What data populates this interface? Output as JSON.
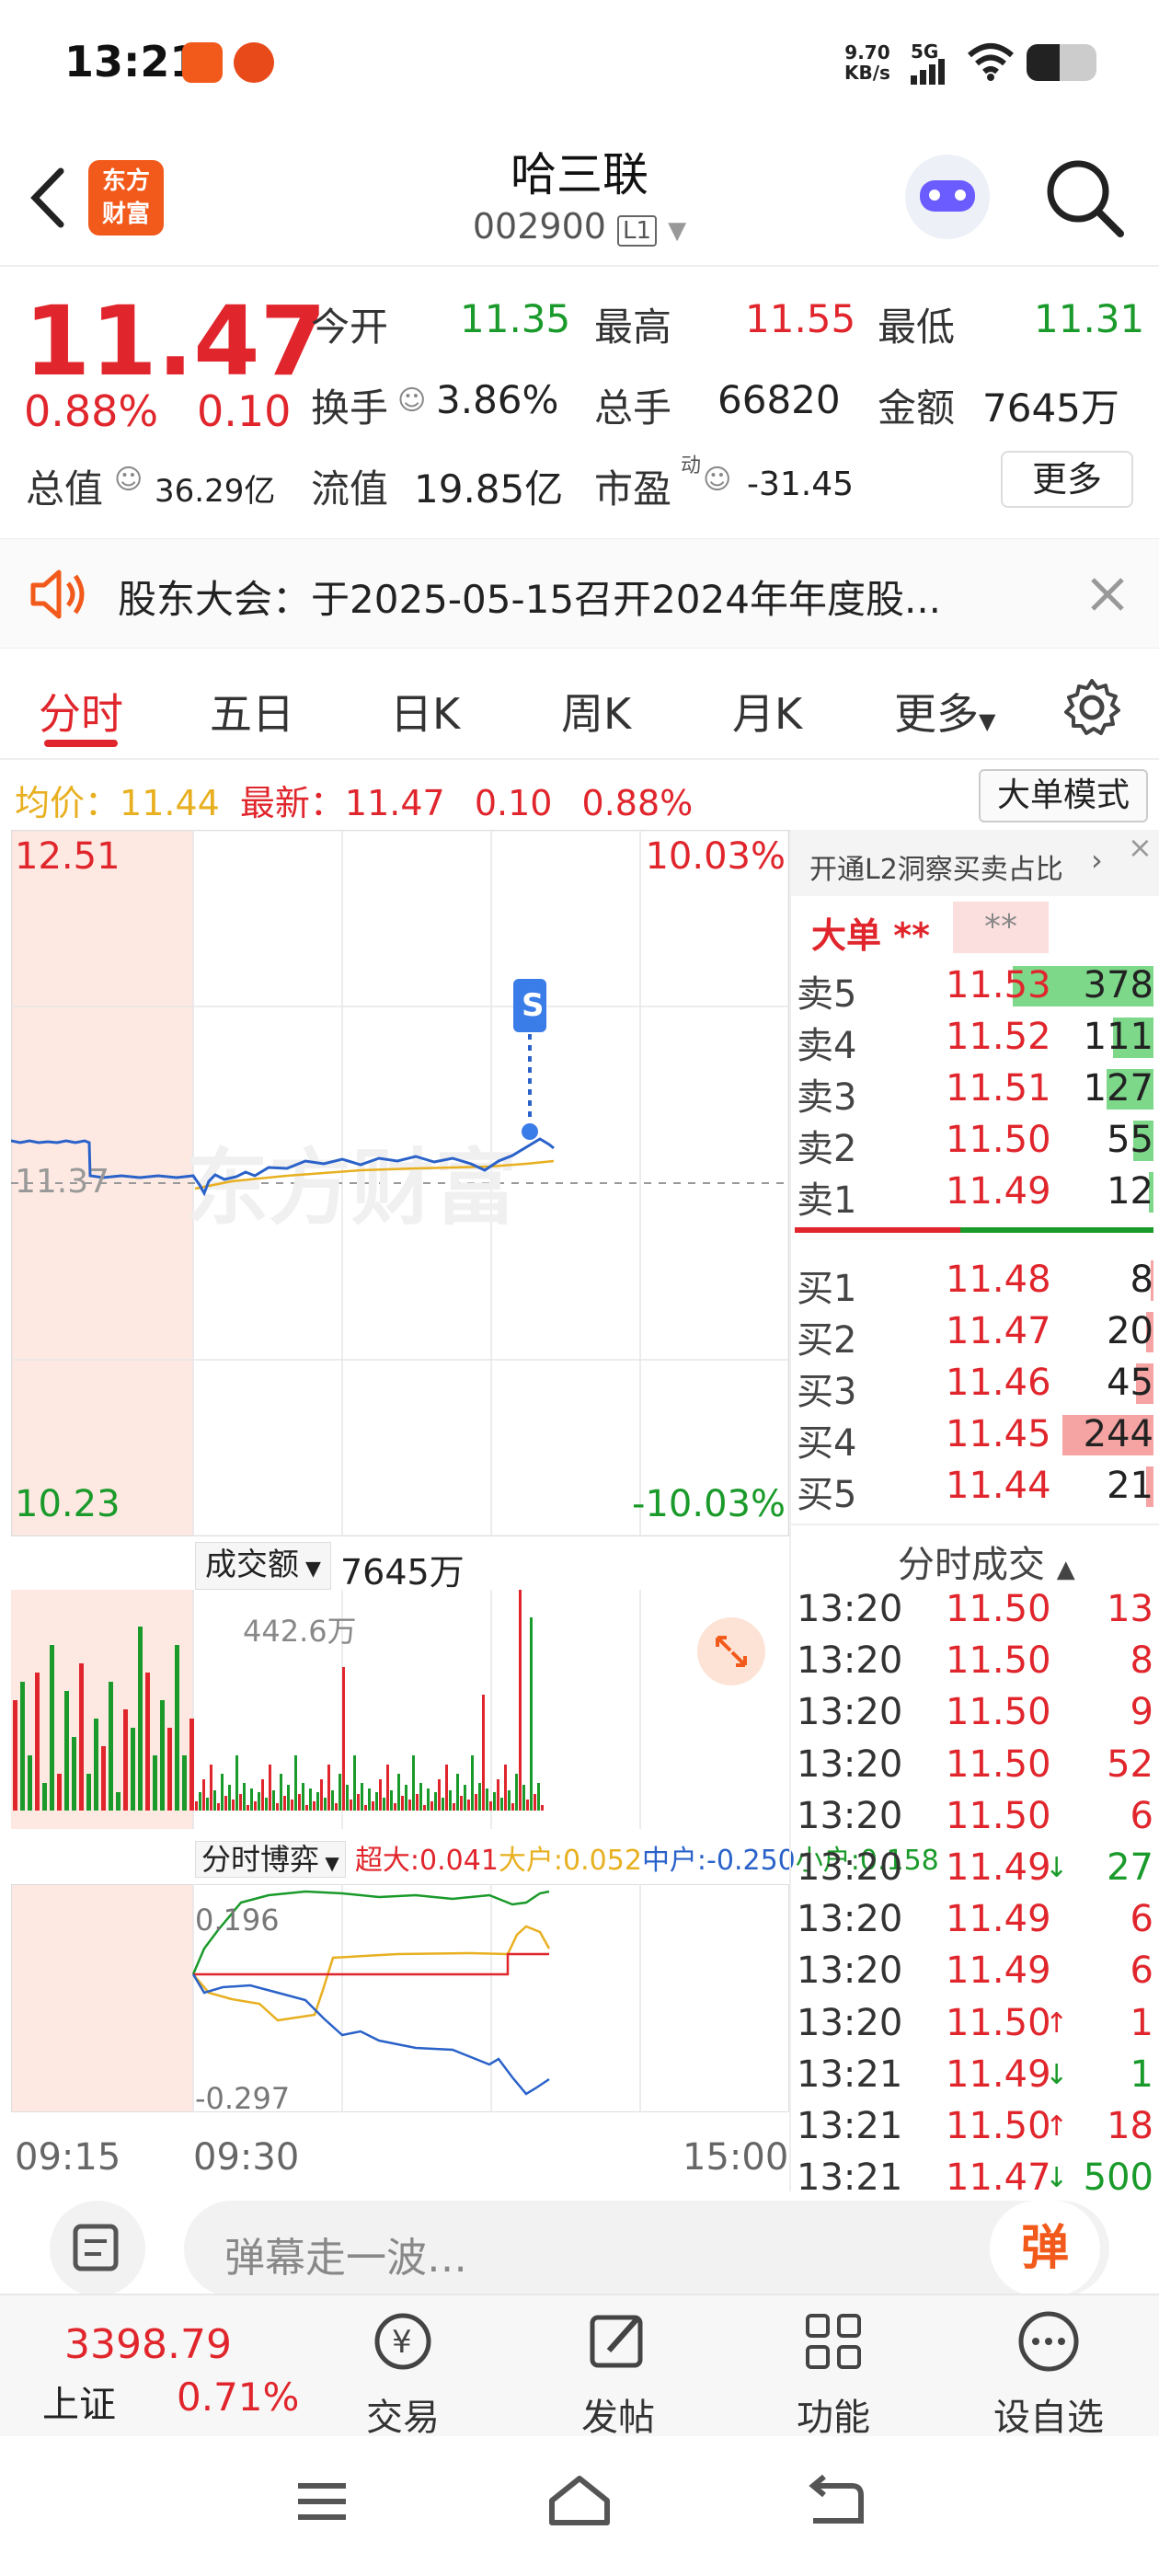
{
  "status": {
    "time": "13:21",
    "speed_value": "9.70",
    "speed_unit": "KB/s",
    "network": "5G"
  },
  "header": {
    "logo_line1": "东方",
    "logo_line2": "财富",
    "title": "哈三联",
    "code": "002900",
    "level": "L1"
  },
  "quote": {
    "price": "11.47",
    "change_pct": "0.88%",
    "change": "0.10",
    "open_label": "今开",
    "open": "11.35",
    "high_label": "最高",
    "high": "11.55",
    "low_label": "最低",
    "low": "11.31",
    "turnover_label": "换手",
    "turnover": "3.86%",
    "volume_label": "总手",
    "volume": "66820",
    "amount_label": "金额",
    "amount": "7645万",
    "mktcap_label": "总值",
    "mktcap": "36.29亿",
    "float_label": "流值",
    "float": "19.85亿",
    "pe_label": "市盈",
    "pe_sup": "动",
    "pe": "-31.45",
    "more": "更多"
  },
  "notice": {
    "text": "股东大会：于2025-05-15召开2024年年度股..."
  },
  "tabs": [
    "分时",
    "五日",
    "日K",
    "周K",
    "月K",
    "更多"
  ],
  "info": {
    "avg_label": "均价：",
    "avg": "11.44",
    "latest_label": "最新：",
    "latest": "11.47",
    "chg": "0.10",
    "pct": "0.88%",
    "mode_button": "大单模式"
  },
  "price_chart": {
    "top": "12.51",
    "mid": "11.37",
    "bottom": "10.23",
    "top_pct": "10.03%",
    "bottom_pct": "-10.03%",
    "watermark": "东方财富",
    "marker": "S"
  },
  "volume_chart": {
    "selector": "成交额",
    "total": "7645万",
    "max_label": "442.6万"
  },
  "bogame": {
    "selector": "分时博弈",
    "chaoda": "超大:0.041",
    "dahu": "大户:0.052",
    "zhonghu": "中户:-0.250",
    "xiaohu": "小户:0.158",
    "max_label": "0.196",
    "min_label": "-0.297"
  },
  "time_axis": {
    "start": "09:15",
    "open": "09:30",
    "end": "15:00"
  },
  "order_book": {
    "l2_banner": "开通L2洞察买卖占比",
    "big_label": "大单",
    "big_v1": "**",
    "big_v2": "**",
    "asks": [
      {
        "label": "卖5",
        "price": "11.53",
        "vol": "378",
        "bar": 0.9
      },
      {
        "label": "卖4",
        "price": "11.52",
        "vol": "111",
        "bar": 0.26
      },
      {
        "label": "卖3",
        "price": "11.51",
        "vol": "127",
        "bar": 0.3
      },
      {
        "label": "卖2",
        "price": "11.50",
        "vol": "55",
        "bar": 0.13
      },
      {
        "label": "卖1",
        "price": "11.49",
        "vol": "12",
        "bar": 0.03
      }
    ],
    "bids": [
      {
        "label": "买1",
        "price": "11.48",
        "vol": "8",
        "bar": 0.02
      },
      {
        "label": "买2",
        "price": "11.47",
        "vol": "20",
        "bar": 0.05
      },
      {
        "label": "买3",
        "price": "11.46",
        "vol": "45",
        "bar": 0.11
      },
      {
        "label": "买4",
        "price": "11.45",
        "vol": "244",
        "bar": 0.58
      },
      {
        "label": "买5",
        "price": "11.44",
        "vol": "21",
        "bar": 0.05
      }
    ]
  },
  "trades": {
    "title": "分时成交",
    "rows": [
      {
        "time": "13:20",
        "price": "11.50",
        "vol": "13",
        "arrow": ""
      },
      {
        "time": "13:20",
        "price": "11.50",
        "vol": "8",
        "arrow": ""
      },
      {
        "time": "13:20",
        "price": "11.50",
        "vol": "9",
        "arrow": ""
      },
      {
        "time": "13:20",
        "price": "11.50",
        "vol": "52",
        "arrow": ""
      },
      {
        "time": "13:20",
        "price": "11.50",
        "vol": "6",
        "arrow": ""
      },
      {
        "time": "13:20",
        "price": "11.49",
        "vol": "27",
        "arrow": "↓"
      },
      {
        "time": "13:20",
        "price": "11.49",
        "vol": "6",
        "arrow": ""
      },
      {
        "time": "13:20",
        "price": "11.49",
        "vol": "6",
        "arrow": ""
      },
      {
        "time": "13:20",
        "price": "11.50",
        "vol": "1",
        "arrow": "↑"
      },
      {
        "time": "13:21",
        "price": "11.49",
        "vol": "1",
        "arrow": "↓"
      },
      {
        "time": "13:21",
        "price": "11.50",
        "vol": "18",
        "arrow": "↑"
      },
      {
        "time": "13:21",
        "price": "11.47",
        "vol": "500",
        "arrow": "↓"
      }
    ]
  },
  "input": {
    "placeholder": "弹幕走一波…",
    "danmu": "弹"
  },
  "bottom_nav": {
    "index_value": "3398.79",
    "index_name": "上证",
    "index_pct": "0.71%",
    "trade": "交易",
    "post": "发帖",
    "func": "功能",
    "watch": "设自选"
  },
  "colors": {
    "red": "#e0262c",
    "green": "#1a9a2a",
    "orange": "#f25a1b",
    "blue": "#2a62c9",
    "yellow": "#e8b020"
  }
}
